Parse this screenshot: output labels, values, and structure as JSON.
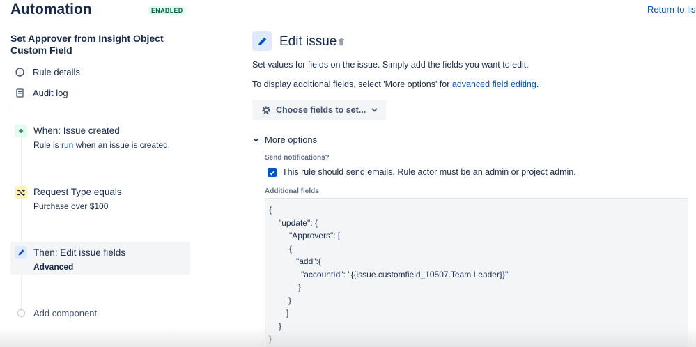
{
  "header": {
    "title": "Automation",
    "status": "ENABLED",
    "return_link": "Return to lis"
  },
  "sidebar": {
    "rule_name": "Set Approver from Insight Object Custom Field",
    "nav": [
      {
        "label": "Rule details",
        "icon": "info-icon"
      },
      {
        "label": "Audit log",
        "icon": "document-icon"
      }
    ],
    "components": [
      {
        "title": "When: Issue created",
        "sub_pre": "Rule is ",
        "sub_link": "run",
        "sub_post": " when an issue is created.",
        "icon": "plus-icon",
        "color": "#e3fcef"
      },
      {
        "title": "Request Type equals",
        "sub": "Purchase over $100",
        "icon": "shuffle-icon",
        "color": "#fff0b3"
      },
      {
        "title": "Then: Edit issue fields",
        "sub": "Advanced",
        "icon": "pencil-icon",
        "color": "#deebff"
      }
    ],
    "add_component": "Add component"
  },
  "main": {
    "action_title": "Edit issue",
    "desc1": "Set values for fields on the issue. Simply add the fields you want to edit.",
    "desc2_pre": "To display additional fields, select 'More options' for ",
    "desc2_link": "advanced field editing",
    "desc2_post": ".",
    "choose_fields": "Choose fields to set...",
    "more_options": "More options",
    "send_notifications_label": "Send notifications?",
    "checkbox_label": "This rule should send emails. Rule actor must be an admin or project admin.",
    "additional_fields_label": "Additional fields",
    "code_lines": [
      "{",
      "\"update\": {",
      "\"Approvers\": [",
      "{",
      "\"add\":{",
      "\"accountId\": \"{{issue.customfield_10507.Team Leader}}\"",
      "}",
      "}",
      "]",
      "}",
      "}"
    ]
  }
}
